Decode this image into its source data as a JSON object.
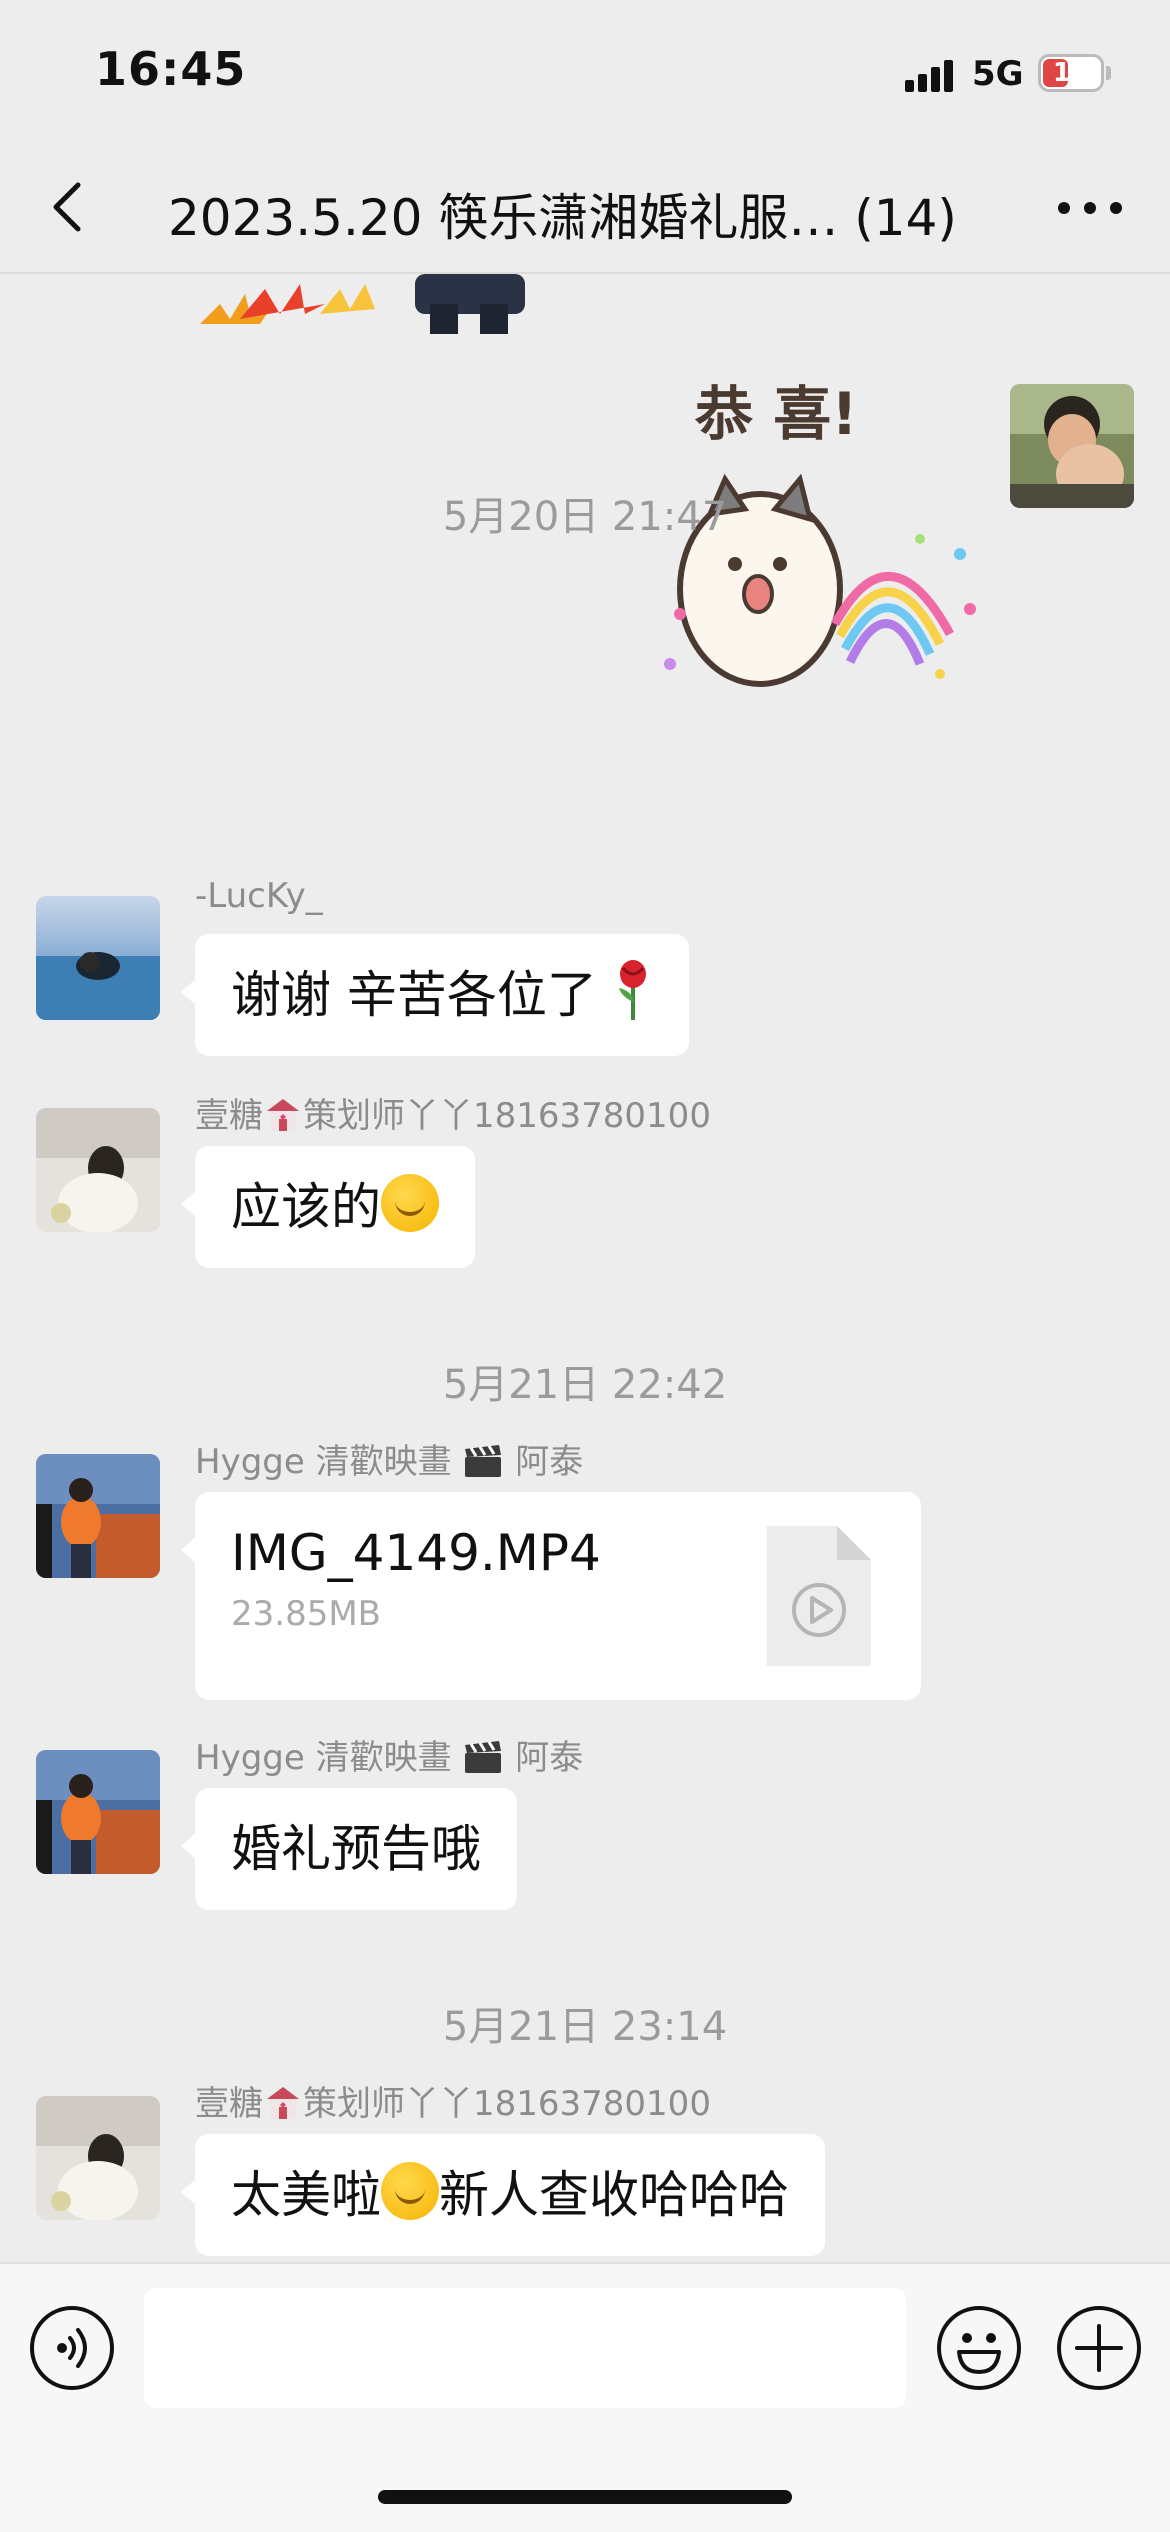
{
  "status_bar": {
    "time": "16:45",
    "network": "5G",
    "battery": "11",
    "battery_level": 0.11
  },
  "nav": {
    "title": "2023.5.20 筷乐潇湘婚礼服…  (14)"
  },
  "messages": [
    {
      "type": "sticker",
      "side": "right",
      "sticker_text": "恭 喜!"
    },
    {
      "type": "timestamp",
      "text": "5月20日 21:47"
    },
    {
      "type": "text",
      "side": "left",
      "sender": "-LucKy_",
      "text": "谢谢 辛苦各位了",
      "emoji": "rose-icon"
    },
    {
      "type": "text",
      "side": "left",
      "sender": "壹糖",
      "sender_suffix": "策划师丫丫18163780100",
      "text": "应该的",
      "emoji": "thinking-face-icon"
    },
    {
      "type": "timestamp",
      "text": "5月21日 22:42"
    },
    {
      "type": "file",
      "side": "left",
      "sender": "Hygge 清歡映畫",
      "sender_suffix": "阿泰",
      "file_name": "IMG_4149.MP4",
      "file_size": "23.85MB"
    },
    {
      "type": "text",
      "side": "left",
      "sender": "Hygge 清歡映畫",
      "sender_suffix": "阿泰",
      "text": "婚礼预告哦"
    },
    {
      "type": "timestamp",
      "text": "5月21日 23:14"
    },
    {
      "type": "text",
      "side": "left",
      "sender": "壹糖",
      "sender_suffix": "策划师丫丫18163780100",
      "text_before": "太美啦",
      "text_after": "新人查收哈哈哈",
      "emoji": "thinking-face-icon"
    }
  ],
  "input": {
    "placeholder": ""
  }
}
